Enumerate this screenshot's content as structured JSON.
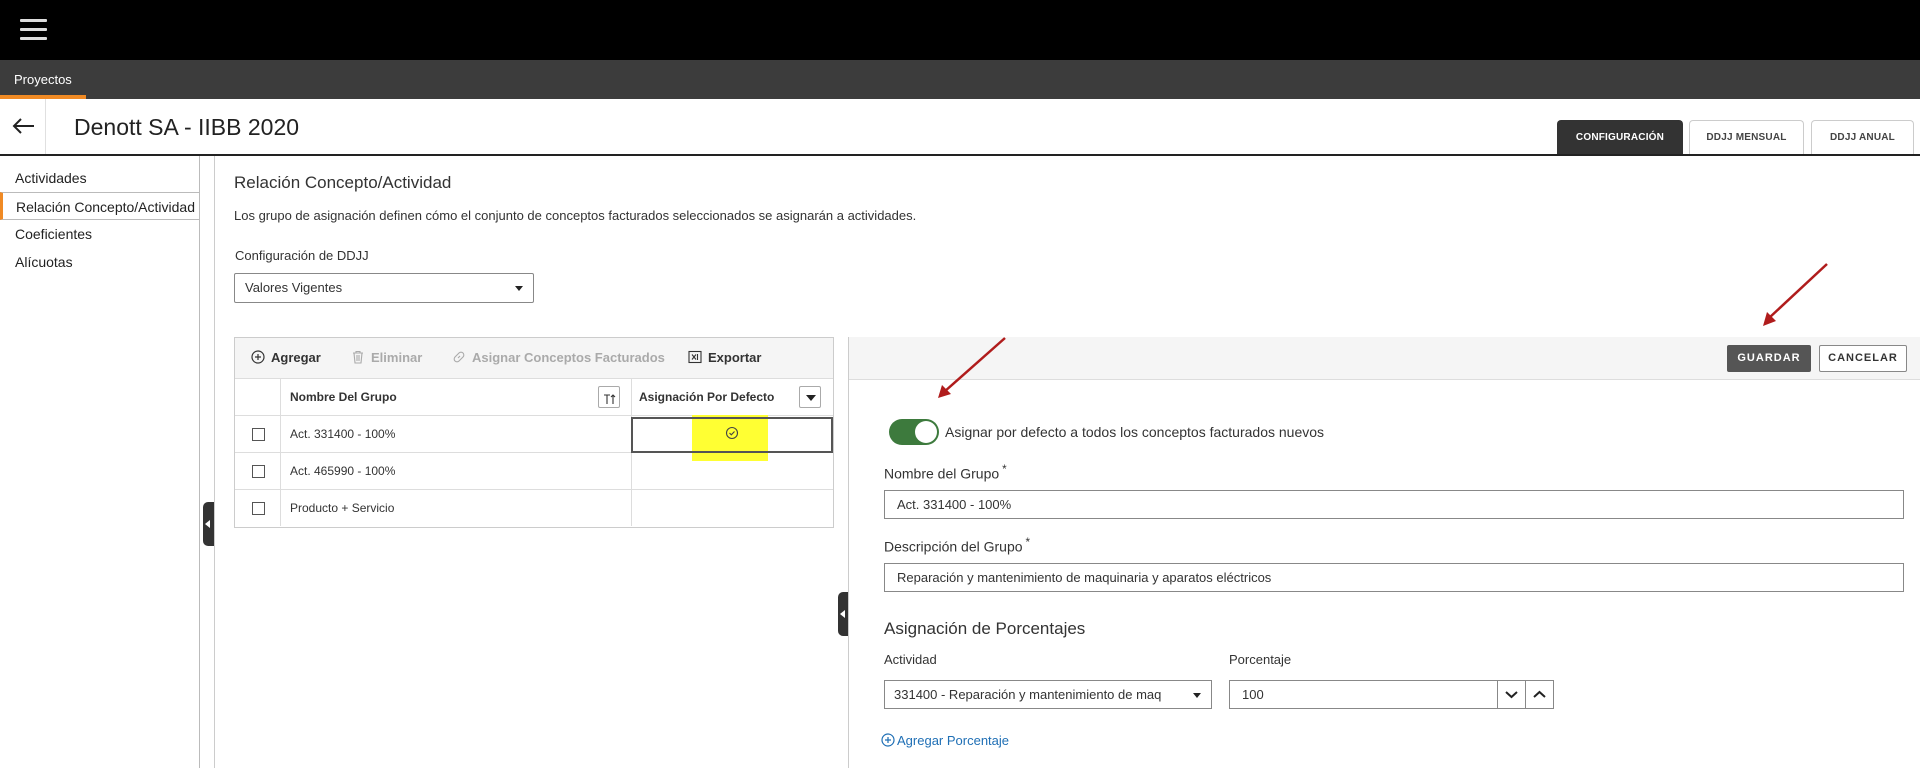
{
  "nav": {
    "tab": "Proyectos"
  },
  "header": {
    "title": "Denott SA - IIBB 2020",
    "tabs": [
      {
        "label": "CONFIGURACIÓN"
      },
      {
        "label": "DDJJ MENSUAL"
      },
      {
        "label": "DDJJ ANUAL"
      }
    ]
  },
  "sidebar": {
    "items": [
      {
        "label": "Actividades"
      },
      {
        "label": "Relación Concepto/Actividad"
      },
      {
        "label": "Coeficientes"
      },
      {
        "label": "Alícuotas"
      }
    ]
  },
  "main": {
    "title": "Relación Concepto/Actividad",
    "description": "Los grupo de asignación definen cómo el conjunto de conceptos facturados seleccionados se asignarán a actividades.",
    "config_label": "Configuración de DDJJ",
    "config_value": "Valores Vigentes"
  },
  "grid": {
    "toolbar": {
      "add": "Agregar",
      "delete": "Eliminar",
      "assign": "Asignar Conceptos Facturados",
      "export": "Exportar"
    },
    "columns": {
      "name": "Nombre Del Grupo",
      "default": "Asignación Por Defecto"
    },
    "rows": [
      {
        "name": "Act. 331400 - 100%",
        "is_default": true
      },
      {
        "name": "Act. 465990 - 100%",
        "is_default": false
      },
      {
        "name": "Producto + Servicio",
        "is_default": false
      }
    ]
  },
  "form": {
    "save": "GUARDAR",
    "cancel": "CANCELAR",
    "toggle_label": "Asignar por defecto a todos los conceptos facturados nuevos",
    "toggle_on": true,
    "group_name_label": "Nombre del Grupo",
    "group_name_value": "Act. 331400 - 100%",
    "group_desc_label": "Descripción del Grupo",
    "group_desc_value": "Reparación y mantenimiento de maquinaria y aparatos eléctricos",
    "required_mark": "*",
    "percent_section_title": "Asignación de Porcentajes",
    "activity_label": "Actividad",
    "activity_value": "331400 - Reparación y mantenimiento de maq",
    "percent_label": "Porcentaje",
    "percent_value": "100",
    "add_percent": "Agregar Porcentaje"
  },
  "colors": {
    "accent_orange": "#f08a24",
    "toggle_green": "#3d7a3d",
    "highlight_yellow": "#ffff33",
    "annotation_red": "#b01c1c",
    "link_blue": "#1f6fb5"
  }
}
